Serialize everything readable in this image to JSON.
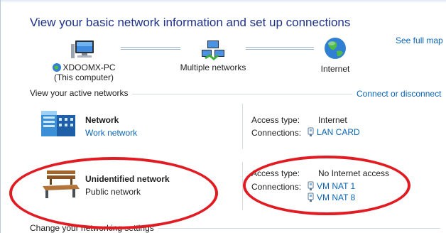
{
  "title": "View your basic network information and set up connections",
  "see_full_map": "See full map",
  "map": {
    "computer": {
      "name": "XDOOMX-PC",
      "sub": "(This computer)"
    },
    "middle": {
      "label": "Multiple networks"
    },
    "internet": {
      "label": "Internet"
    }
  },
  "active": {
    "heading": "View your active networks",
    "connect_link": "Connect or disconnect",
    "networks": [
      {
        "name": "Network",
        "category": "Work network",
        "access_label": "Access type:",
        "access_value": "Internet",
        "connections_label": "Connections:",
        "connections": [
          "LAN CARD"
        ]
      },
      {
        "name": "Unidentified network",
        "category": "Public network",
        "access_label": "Access type:",
        "access_value": "No Internet access",
        "connections_label": "Connections:",
        "connections": [
          "VM NAT 1",
          "VM NAT 8"
        ]
      }
    ]
  },
  "change": {
    "heading": "Change your networking settings"
  },
  "colors": {
    "title": "#1e3287",
    "link": "#0a64b4",
    "highlight": "#e11b22"
  }
}
